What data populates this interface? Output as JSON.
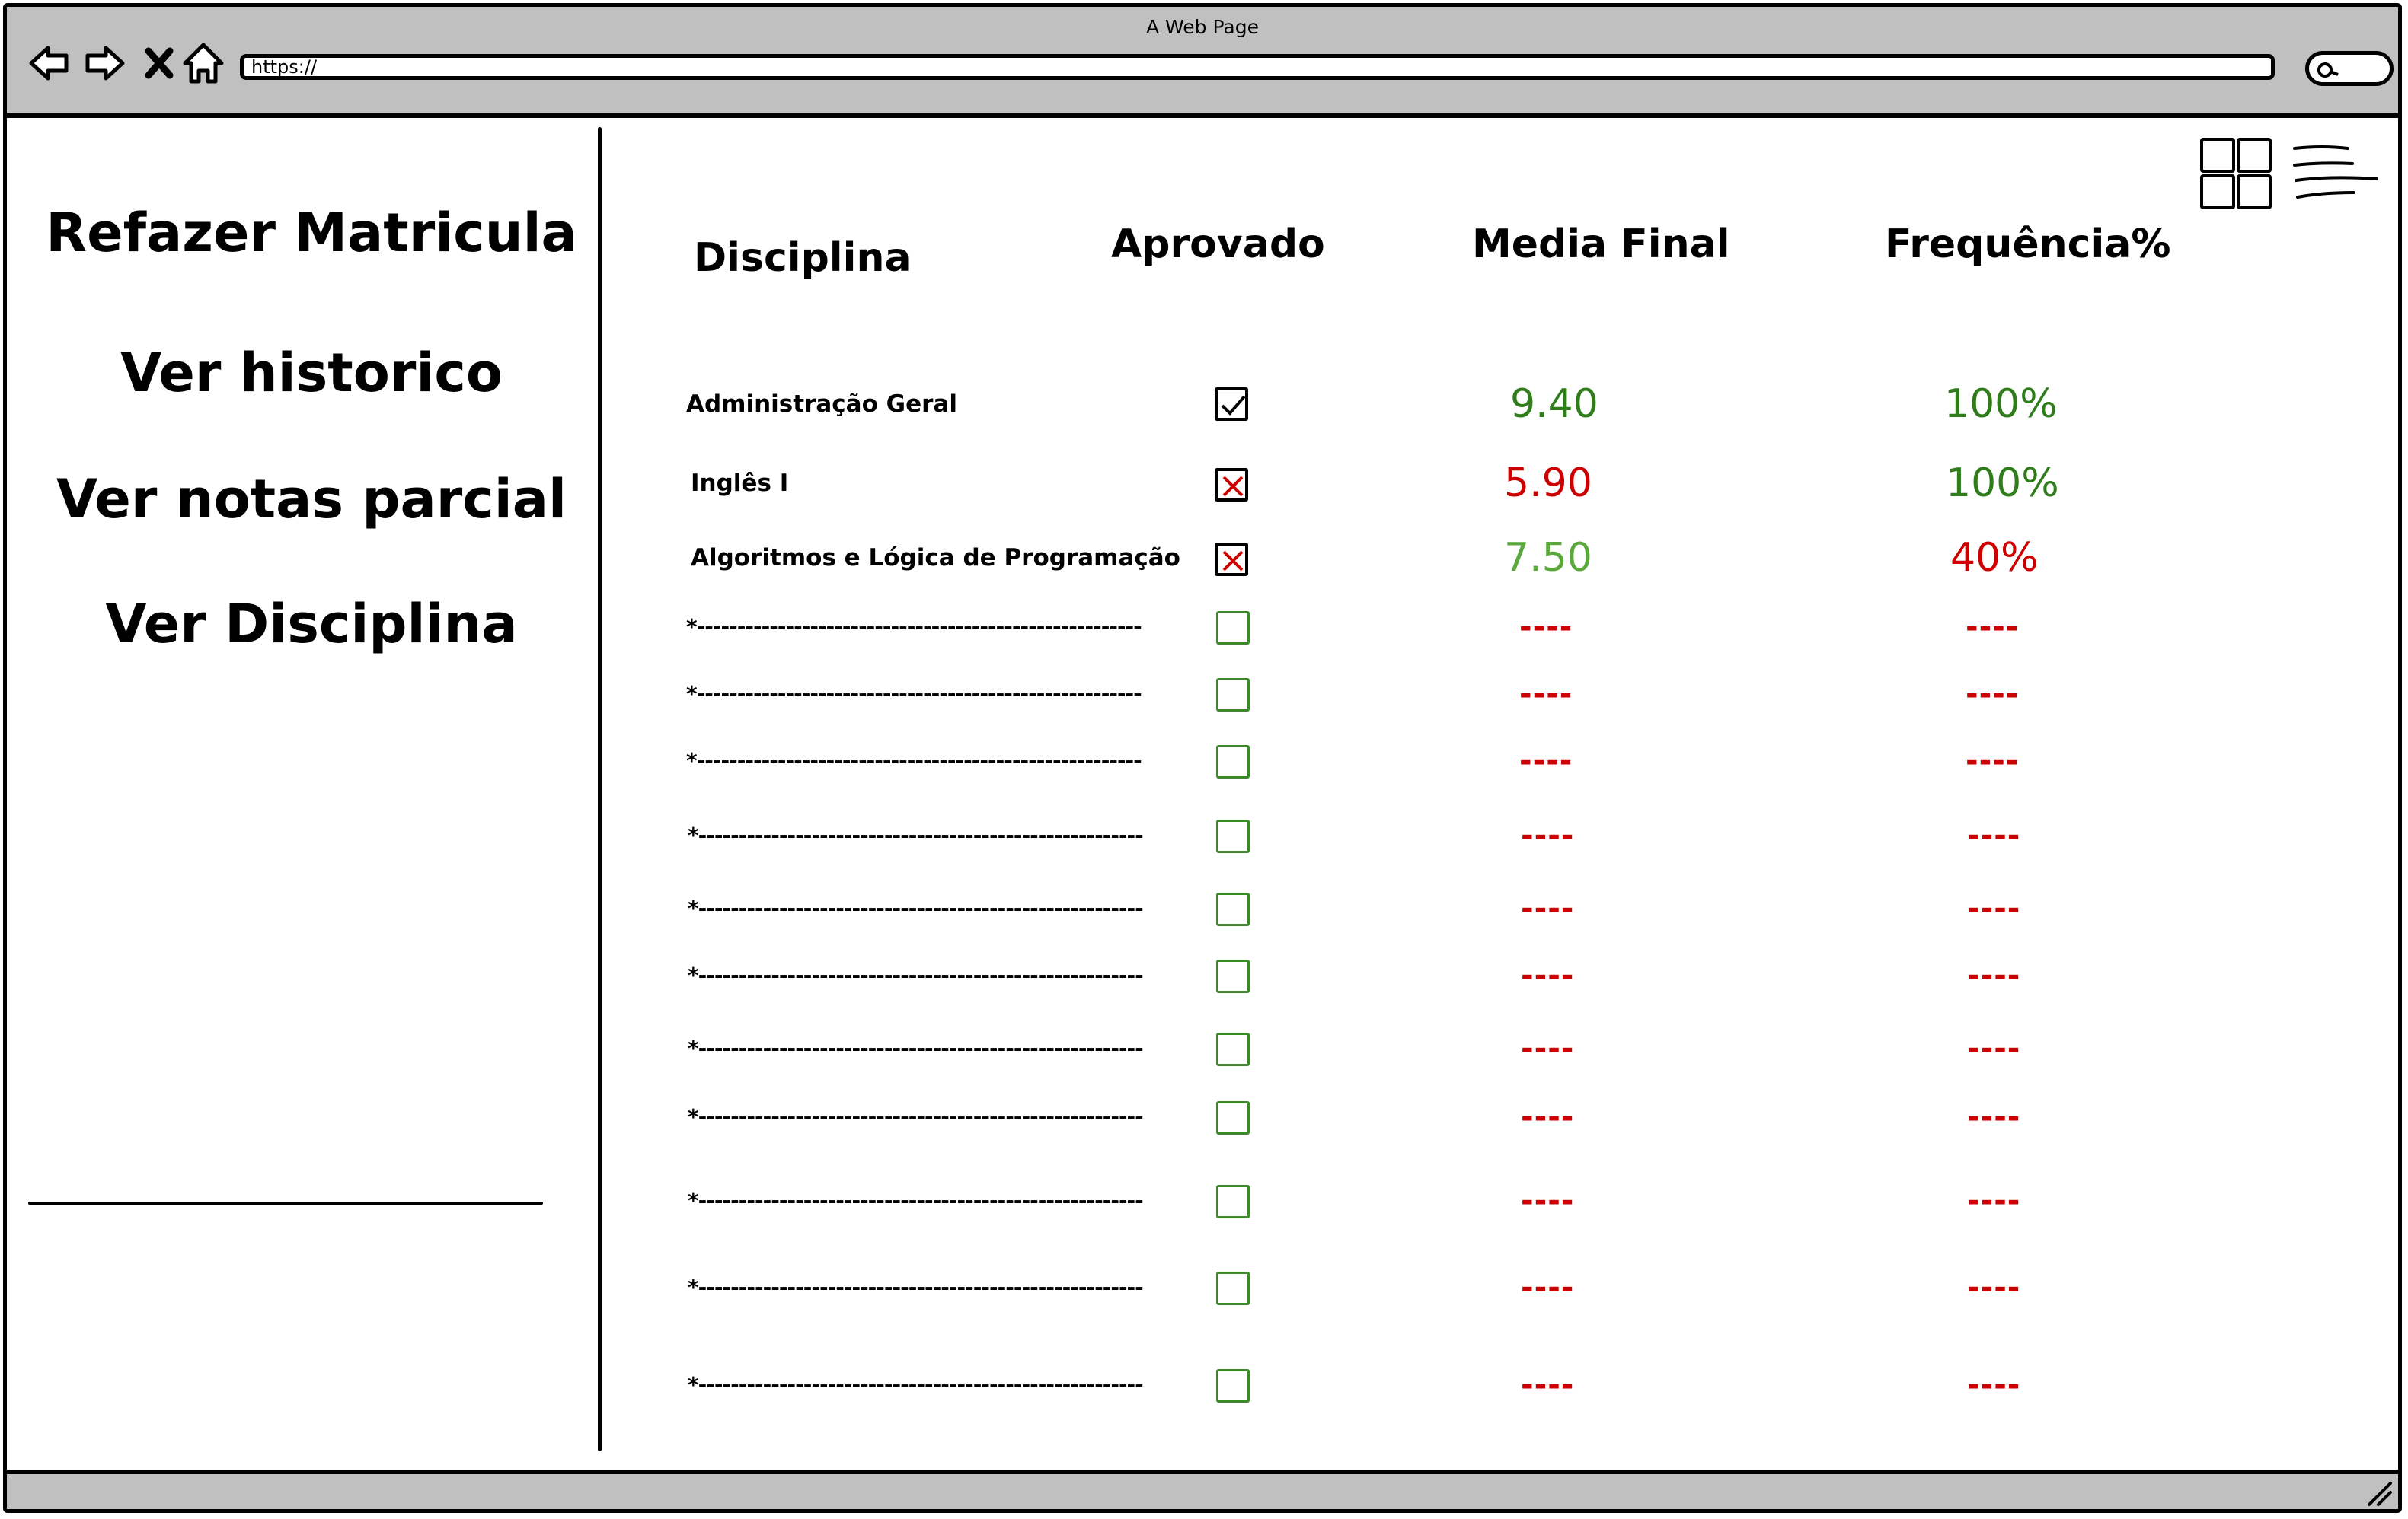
{
  "browser": {
    "title": "A Web Page",
    "url": "https://"
  },
  "sidebar": {
    "items": [
      {
        "label": "Refazer Matricula"
      },
      {
        "label": "Ver historico"
      },
      {
        "label": "Ver notas parcial"
      },
      {
        "label": "Ver Disciplina"
      }
    ]
  },
  "table": {
    "headers": {
      "disciplina": "Disciplina",
      "aprovado": "Aprovado",
      "media": "Media Final",
      "frequencia": "Frequência%"
    },
    "rows": [
      {
        "disciplina": "Administração Geral",
        "aprovado": "checked",
        "media": "9.40",
        "frequencia": "100%"
      },
      {
        "disciplina": "Inglês I",
        "aprovado": "failed",
        "media": "5.90",
        "frequencia": "100%"
      },
      {
        "disciplina": "Algoritmos e Lógica de Programação",
        "aprovado": "failed",
        "media": "7.50",
        "frequencia": "40%"
      },
      {
        "disciplina": "*-------------------------------------------------------",
        "aprovado": "empty",
        "media": "----",
        "frequencia": "----"
      },
      {
        "disciplina": "*-------------------------------------------------------",
        "aprovado": "empty",
        "media": "----",
        "frequencia": "----"
      },
      {
        "disciplina": "*-------------------------------------------------------",
        "aprovado": "empty",
        "media": "----",
        "frequencia": "----"
      },
      {
        "disciplina": "*-------------------------------------------------------",
        "aprovado": "empty",
        "media": "----",
        "frequencia": "----"
      },
      {
        "disciplina": "*-------------------------------------------------------",
        "aprovado": "empty",
        "media": "----",
        "frequencia": "----"
      },
      {
        "disciplina": "*-------------------------------------------------------",
        "aprovado": "empty",
        "media": "----",
        "frequencia": "----"
      },
      {
        "disciplina": "*-------------------------------------------------------",
        "aprovado": "empty",
        "media": "----",
        "frequencia": "----"
      },
      {
        "disciplina": "*-------------------------------------------------------",
        "aprovado": "empty",
        "media": "----",
        "frequencia": "----"
      },
      {
        "disciplina": "*-------------------------------------------------------",
        "aprovado": "empty",
        "media": "----",
        "frequencia": "----"
      },
      {
        "disciplina": "*-------------------------------------------------------",
        "aprovado": "empty",
        "media": "----",
        "frequencia": "----"
      },
      {
        "disciplina": "*-------------------------------------------------------",
        "aprovado": "empty",
        "media": "----",
        "frequencia": "----"
      }
    ]
  },
  "colors": {
    "good": "#2e7d1a",
    "light_good": "#5aa83c",
    "bad": "#cc0000",
    "checkbox_border": "#3a8a2a",
    "chrome": "#c0c0c0"
  },
  "icons": {
    "back": "back-arrow-icon",
    "forward": "forward-arrow-icon",
    "stop": "close-icon",
    "home": "home-icon",
    "search": "search-icon",
    "grid": "grid-view-icon",
    "list": "list-view-icon",
    "resize": "resize-grip-icon"
  }
}
